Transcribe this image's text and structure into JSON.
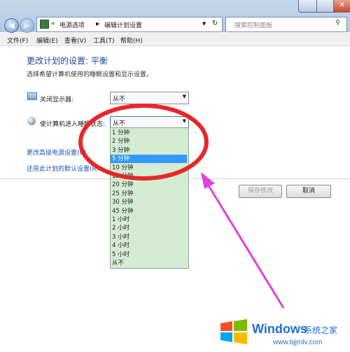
{
  "window": {
    "breadcrumb_prefix": "«",
    "breadcrumb": [
      "电源选项",
      "编辑计划设置"
    ],
    "search_placeholder": "搜索控制面板"
  },
  "menu": [
    "文件(F)",
    "编辑(E)",
    "查看(V)",
    "工具(T)",
    "帮助(H)"
  ],
  "page": {
    "title": "更改计划的设置: 平衡",
    "description": "选择希望计算机使用的睡眠设置和显示设置。"
  },
  "settings": [
    {
      "label": "关闭显示器:",
      "value": "从不",
      "icon": "monitor-icon"
    },
    {
      "label": "使计算机进入睡眠状态:",
      "value": "从不",
      "icon": "moon-icon"
    }
  ],
  "links": {
    "advanced": "更改高级电源设置(C)",
    "restore": "还原此计划的默认设置(R)"
  },
  "buttons": {
    "save": "保存修改",
    "cancel": "取消"
  },
  "dropdown": {
    "options": [
      "1 分钟",
      "2 分钟",
      "3 分钟",
      "5 分钟",
      "10 分钟",
      "15 分钟",
      "20 分钟",
      "25 分钟",
      "30 分钟",
      "45 分钟",
      "1 小时",
      "2 小时",
      "3 小时",
      "4 小时",
      "5 小时",
      "从不"
    ],
    "selected_index": 3
  },
  "watermark": {
    "brand": "Windows",
    "site": "系统之家",
    "url": "www.bjjmlv.com"
  },
  "colors": {
    "accent": "#1d4a8f",
    "annotation": "#e8262a",
    "arrow": "#e040e0",
    "highlight": "#3399ff"
  }
}
